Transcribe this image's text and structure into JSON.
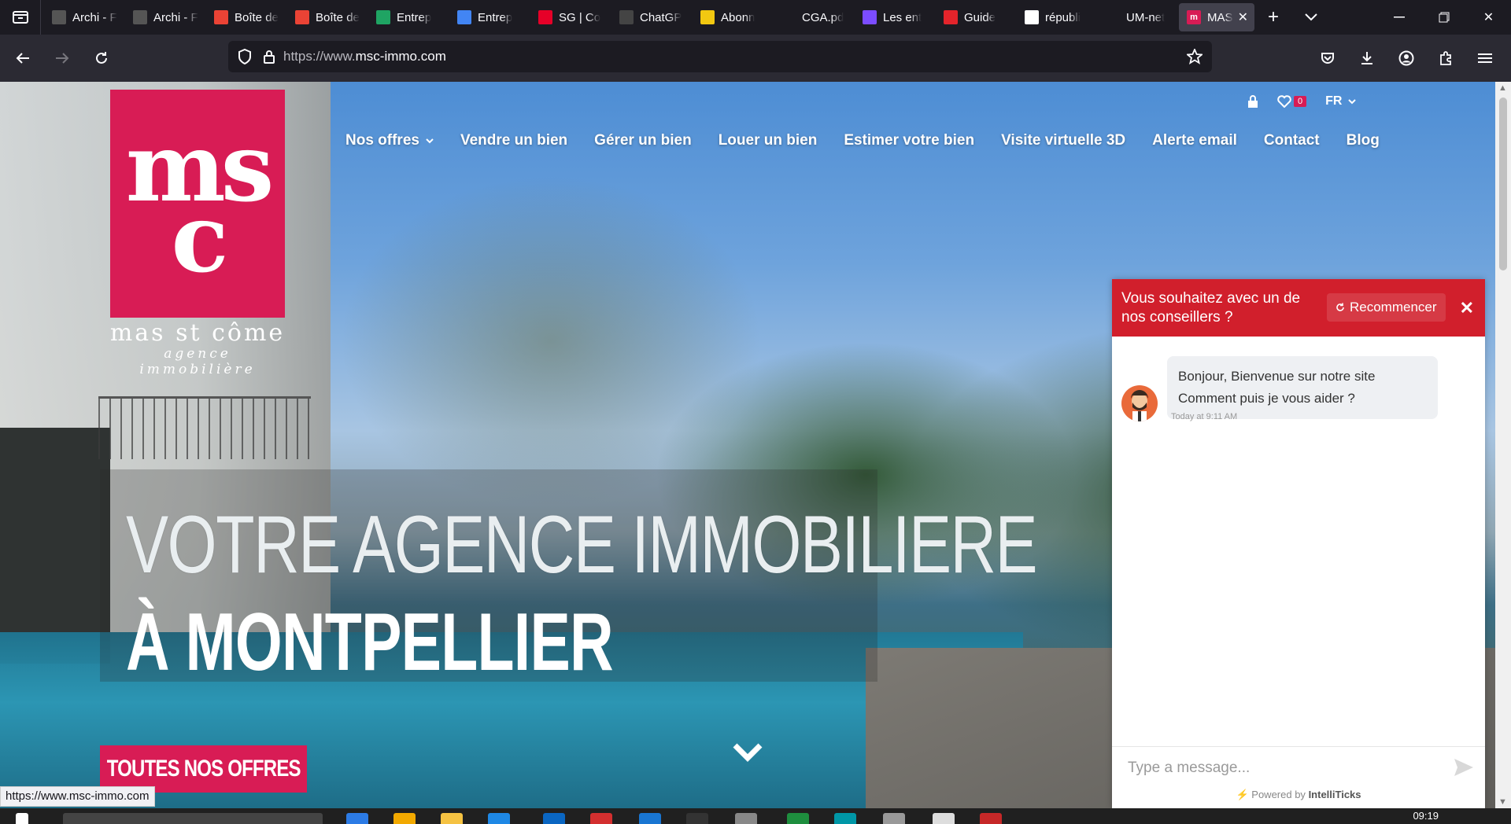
{
  "browser": {
    "tabs": [
      {
        "title": "Archi - Free",
        "favicon": "archi-favicon",
        "color": "#555"
      },
      {
        "title": "Archi - Free",
        "favicon": "archi-favicon",
        "color": "#555"
      },
      {
        "title": "Boîte de",
        "favicon": "gmail-icon",
        "color": "#ea4335"
      },
      {
        "title": "Boîte de",
        "favicon": "gmail-icon",
        "color": "#ea4335"
      },
      {
        "title": "Entrep",
        "favicon": "google-drive-icon",
        "color": "#1fa463"
      },
      {
        "title": "Entrep",
        "favicon": "google-docs-icon",
        "color": "#4285f4"
      },
      {
        "title": "SG | Co",
        "favicon": "societe-generale-icon",
        "color": "#e60028"
      },
      {
        "title": "ChatGP",
        "favicon": "chatgpt-icon",
        "color": "#444"
      },
      {
        "title": "Abonn",
        "favicon": "yahoo-icon",
        "color": "#f2c811"
      },
      {
        "title": "CGA.pd",
        "favicon": "pdf-icon",
        "color": "transparent"
      },
      {
        "title": "Les ent",
        "favicon": "app-icon",
        "color": "#7b4cff"
      },
      {
        "title": "Guide",
        "favicon": "l-icon",
        "color": "#e3242b"
      },
      {
        "title": "républi",
        "favicon": "google-icon",
        "color": "#fff"
      },
      {
        "title": "UM-net",
        "favicon": "umnet-icon",
        "color": "transparent"
      }
    ],
    "active_tab": {
      "title": "MAS",
      "favicon": "msc-favicon",
      "color": "#d81c55"
    },
    "url": {
      "prefix": "https://www.",
      "domain": "msc-immo.com"
    },
    "status_url": "https://www.msc-immo.com"
  },
  "site": {
    "brand_color": "#d81c55",
    "logo": {
      "mark": "msc",
      "name": "mas st côme",
      "tagline": "agence immobilière"
    },
    "favorites_count": "0",
    "language": "FR",
    "nav": [
      {
        "label": "Nos offres",
        "has_dropdown": true
      },
      {
        "label": "Vendre un bien"
      },
      {
        "label": "Gérer un bien"
      },
      {
        "label": "Louer un bien"
      },
      {
        "label": "Estimer votre bien"
      },
      {
        "label": "Visite virtuelle 3D"
      },
      {
        "label": "Alerte email"
      },
      {
        "label": "Contact"
      },
      {
        "label": "Blog"
      }
    ],
    "hero": {
      "title_line1": "VOTRE AGENCE IMMOBILIERE",
      "title_line2": "À MONTPELLIER",
      "cta": "TOUTES NOS OFFRES"
    }
  },
  "chat": {
    "header_color": "#d11f2c",
    "title": "Vous souhaitez avec un de nos conseillers ?",
    "restart_label": "Recommencer",
    "messages": [
      {
        "line1": "Bonjour, Bienvenue sur notre site",
        "line2": "Comment puis je vous aider ?",
        "time": "Today at 9:11 AM"
      }
    ],
    "input_placeholder": "Type a message...",
    "powered_prefix": "Powered by",
    "powered_brand": "IntelliTicks"
  },
  "taskbar": {
    "clock": "09:19"
  }
}
